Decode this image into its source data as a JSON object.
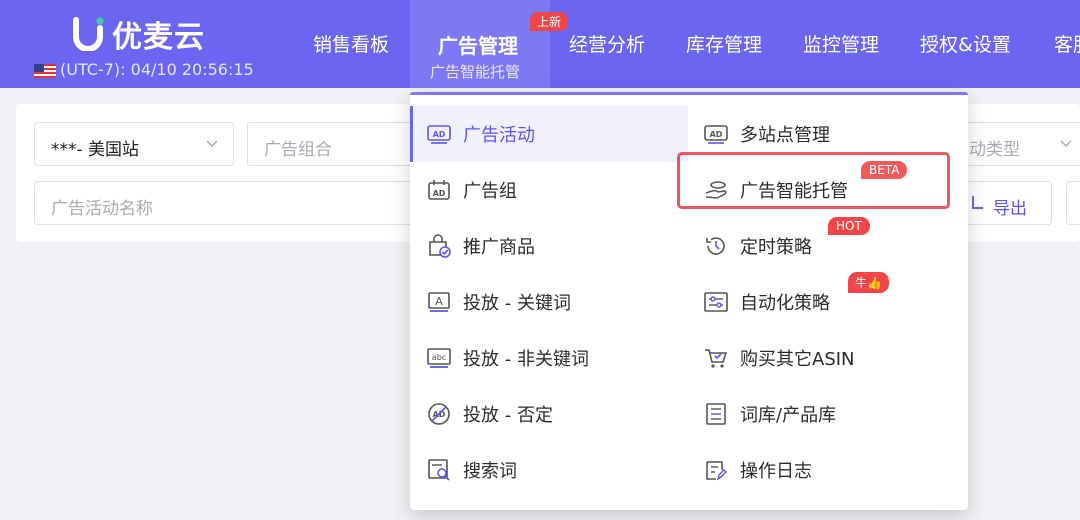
{
  "header": {
    "logo_text": "优麦云",
    "timezone": "(UTC-7): 04/10 20:56:15",
    "nav": [
      {
        "label": "销售看板"
      },
      {
        "label": "广告管理",
        "sub": "广告智能托管",
        "badge": "上新",
        "active": true
      },
      {
        "label": "经营分析"
      },
      {
        "label": "库存管理"
      },
      {
        "label": "监控管理"
      },
      {
        "label": "授权&设置"
      },
      {
        "label": "客服"
      }
    ],
    "colors": {
      "primary": "#6b66f2",
      "badge": "#f0464a"
    }
  },
  "filters": {
    "site_select": "***- 美国站",
    "ad_group_placeholder": "广告组合",
    "campaign_name_placeholder": "广告活动名称",
    "type_placeholder": "动类型",
    "export_label": "导出"
  },
  "menu": {
    "left": [
      {
        "label": "广告活动",
        "icon": "ad-badge-icon",
        "active": true
      },
      {
        "label": "广告组",
        "icon": "ad-calendar-icon"
      },
      {
        "label": "推广商品",
        "icon": "bag-check-icon"
      },
      {
        "label": "投放 - 关键词",
        "icon": "keyword-a-icon"
      },
      {
        "label": "投放 - 非关键词",
        "icon": "abc-icon"
      },
      {
        "label": "投放 - 否定",
        "icon": "ad-blocked-icon"
      },
      {
        "label": "搜索词",
        "icon": "search-doc-icon"
      }
    ],
    "right": [
      {
        "label": "多站点管理",
        "icon": "ad-badge-icon"
      },
      {
        "label": "广告智能托管",
        "icon": "hand-coin-icon",
        "tag": "BETA",
        "highlighted": true
      },
      {
        "label": "定时策略",
        "icon": "clock-history-icon",
        "tag": "HOT"
      },
      {
        "label": "自动化策略",
        "icon": "sliders-icon",
        "tag": "牛👍"
      },
      {
        "label": "购买其它ASIN",
        "icon": "cart-icon"
      },
      {
        "label": "词库/产品库",
        "icon": "list-book-icon"
      },
      {
        "label": "操作日志",
        "icon": "log-edit-icon"
      }
    ]
  }
}
